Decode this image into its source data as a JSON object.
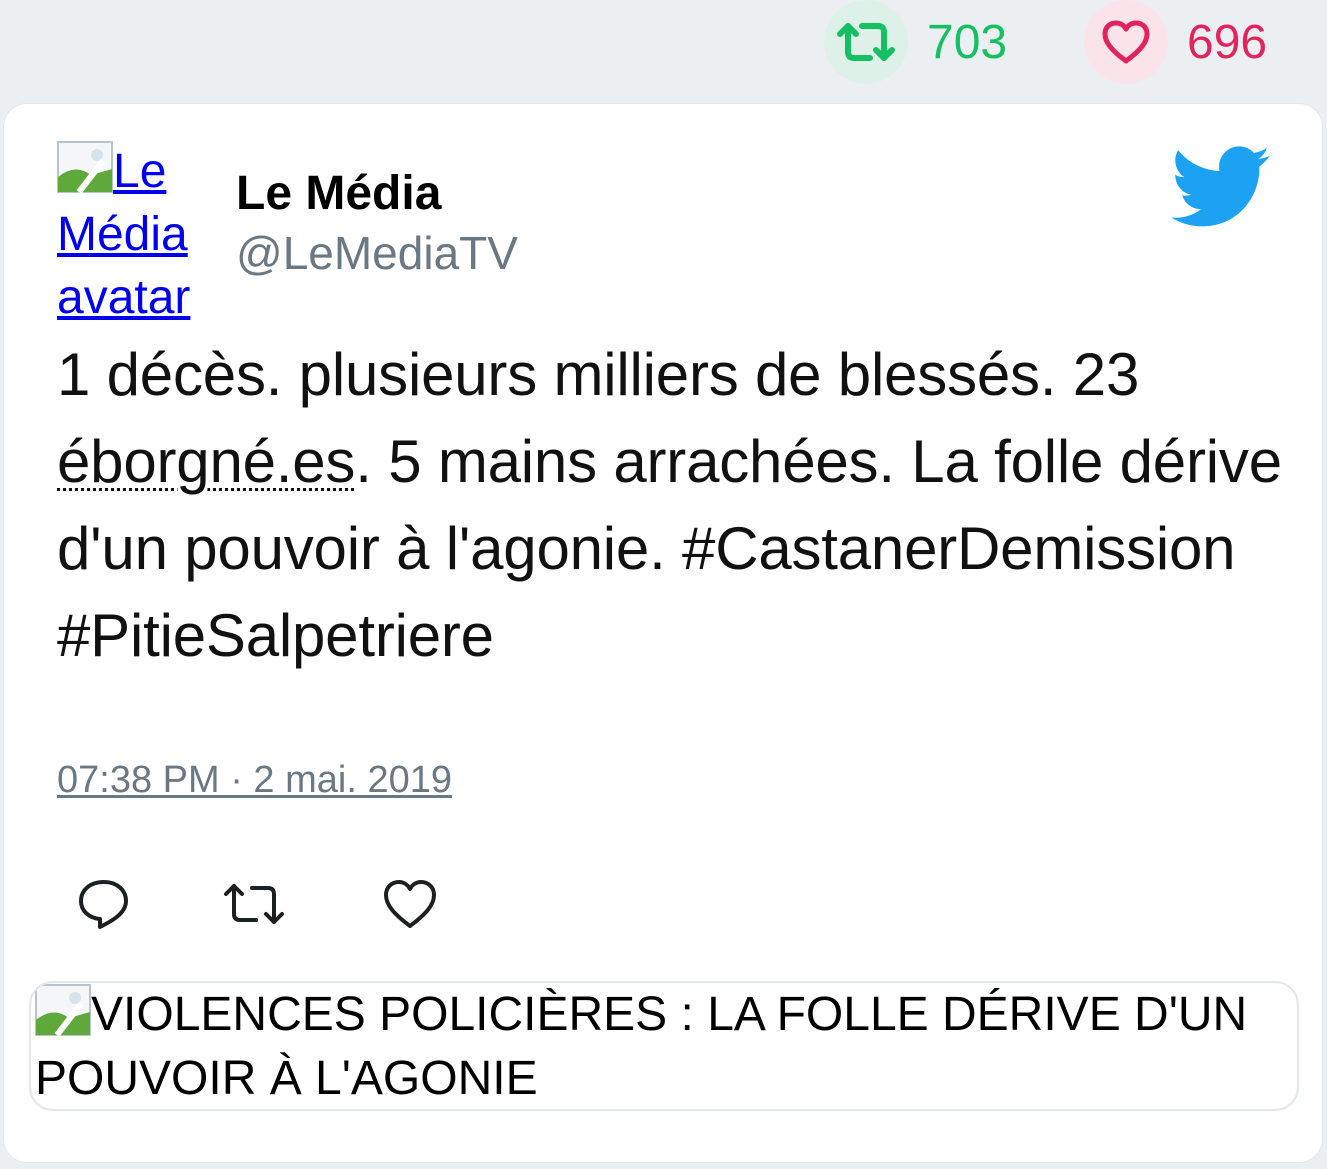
{
  "stats": {
    "retweets": "703",
    "likes": "696",
    "retweet_icon": "retweet-icon",
    "like_icon": "heart-icon",
    "retweet_color": "#17bf63",
    "like_color": "#e0245e"
  },
  "tweet": {
    "avatar_alt": "Le Média avatar",
    "author_name": "Le Média",
    "author_handle": "@LeMediaTV",
    "brand_icon": "twitter-bird-icon",
    "brand_color": "#1da1f2",
    "text_part1": "1 décès. plusieurs milliers de blessés. 23 ",
    "text_abbr": "éborgné.es",
    "text_part2": ". 5 mains arrachées. La folle dérive d'un pouvoir à l'agonie. #CastanerDemission #PitieSalpetriere",
    "timestamp": "07:38 PM · 2 mai. 2019",
    "actions": [
      "reply-icon",
      "retweet-icon",
      "heart-icon"
    ]
  },
  "link_card": {
    "image_alt": "VIOLENCES POLICIÈRES : LA FOLLE DÉRIVE D'UN POUVOIR À L'AGONIE"
  }
}
